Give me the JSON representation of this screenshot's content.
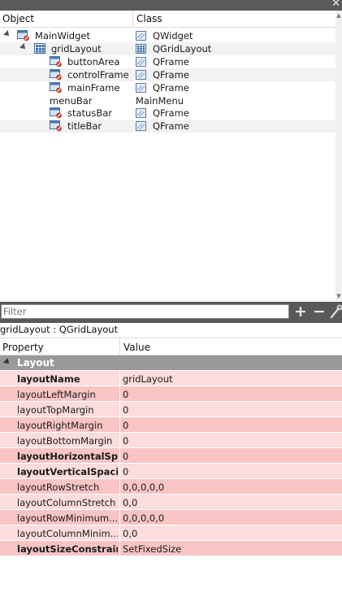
{
  "window": {
    "close_glyph": "✕"
  },
  "object_inspector": {
    "columns": {
      "object": "Object",
      "class": "Class"
    },
    "rows": [
      {
        "name": "MainWidget",
        "class": "QWidget",
        "icon": "widget-icon",
        "class_icon": "widget-class-icon"
      },
      {
        "name": "gridLayout",
        "class": "QGridLayout",
        "icon": "grid-layout-icon",
        "class_icon": "grid-layout-class-icon"
      },
      {
        "name": "buttonArea",
        "class": "QFrame",
        "icon": "frame-icon",
        "class_icon": "frame-class-icon"
      },
      {
        "name": "controlFrame",
        "class": "QFrame",
        "icon": "frame-icon",
        "class_icon": "frame-class-icon"
      },
      {
        "name": "mainFrame",
        "class": "QFrame",
        "icon": "frame-icon",
        "class_icon": "frame-class-icon"
      },
      {
        "name": "menuBar",
        "class": "MainMenu",
        "icon": "",
        "class_icon": ""
      },
      {
        "name": "statusBar",
        "class": "QFrame",
        "icon": "frame-icon",
        "class_icon": "frame-class-icon"
      },
      {
        "name": "titleBar",
        "class": "QFrame",
        "icon": "frame-icon",
        "class_icon": "frame-class-icon"
      }
    ]
  },
  "filter": {
    "placeholder": "Filter",
    "plus": "+",
    "minus": "−"
  },
  "selected_object": "gridLayout : QGridLayout",
  "property_editor": {
    "columns": {
      "property": "Property",
      "value": "Value"
    },
    "group": "Layout",
    "rows": [
      {
        "name": "layoutName",
        "value": "gridLayout"
      },
      {
        "name": "layoutLeftMargin",
        "value": "0"
      },
      {
        "name": "layoutTopMargin",
        "value": "0"
      },
      {
        "name": "layoutRightMargin",
        "value": "0"
      },
      {
        "name": "layoutBottomMargin",
        "value": "0"
      },
      {
        "name": "layoutHorizontalSpa...",
        "value": "0"
      },
      {
        "name": "layoutVerticalSpacing",
        "value": "0"
      },
      {
        "name": "layoutRowStretch",
        "value": "0,0,0,0,0"
      },
      {
        "name": "layoutColumnStretch",
        "value": "0,0"
      },
      {
        "name": "layoutRowMinimum...",
        "value": "0,0,0,0,0"
      },
      {
        "name": "layoutColumnMinim...",
        "value": "0,0"
      },
      {
        "name": "layoutSizeConstraint",
        "value": "SetFixedSize"
      }
    ]
  },
  "colors": {
    "row_light": "#fcdcdc",
    "row_dark": "#f8c4c4",
    "group_header": "#9a9a9a",
    "toolbar": "#595959"
  }
}
